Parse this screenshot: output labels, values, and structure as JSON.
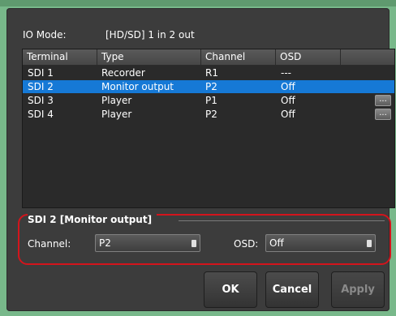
{
  "io_mode": {
    "label": "IO Mode:",
    "value": "[HD/SD] 1 in 2 out"
  },
  "table": {
    "columns": [
      "Terminal",
      "Type",
      "Channel",
      "OSD"
    ],
    "rows": [
      {
        "terminal": "SDI 1",
        "type": "Recorder",
        "channel": "R1",
        "osd": "---",
        "selected": false,
        "has_button": false
      },
      {
        "terminal": "SDI 2",
        "type": "Monitor output",
        "channel": "P2",
        "osd": "Off",
        "selected": true,
        "has_button": false
      },
      {
        "terminal": "SDI 3",
        "type": "Player",
        "channel": "P1",
        "osd": "Off",
        "selected": false,
        "has_button": true
      },
      {
        "terminal": "SDI 4",
        "type": "Player",
        "channel": "P2",
        "osd": "Off",
        "selected": false,
        "has_button": true
      }
    ],
    "row_button_label": "..."
  },
  "settings": {
    "title": "SDI 2 [Monitor output]",
    "channel_label": "Channel:",
    "channel_value": "P2",
    "osd_label": "OSD:",
    "osd_value": "Off"
  },
  "buttons": {
    "ok": "OK",
    "cancel": "Cancel",
    "apply": "Apply"
  },
  "colors": {
    "selection": "#1679d6",
    "highlight": "#d4141c",
    "background": "#78b88a"
  }
}
